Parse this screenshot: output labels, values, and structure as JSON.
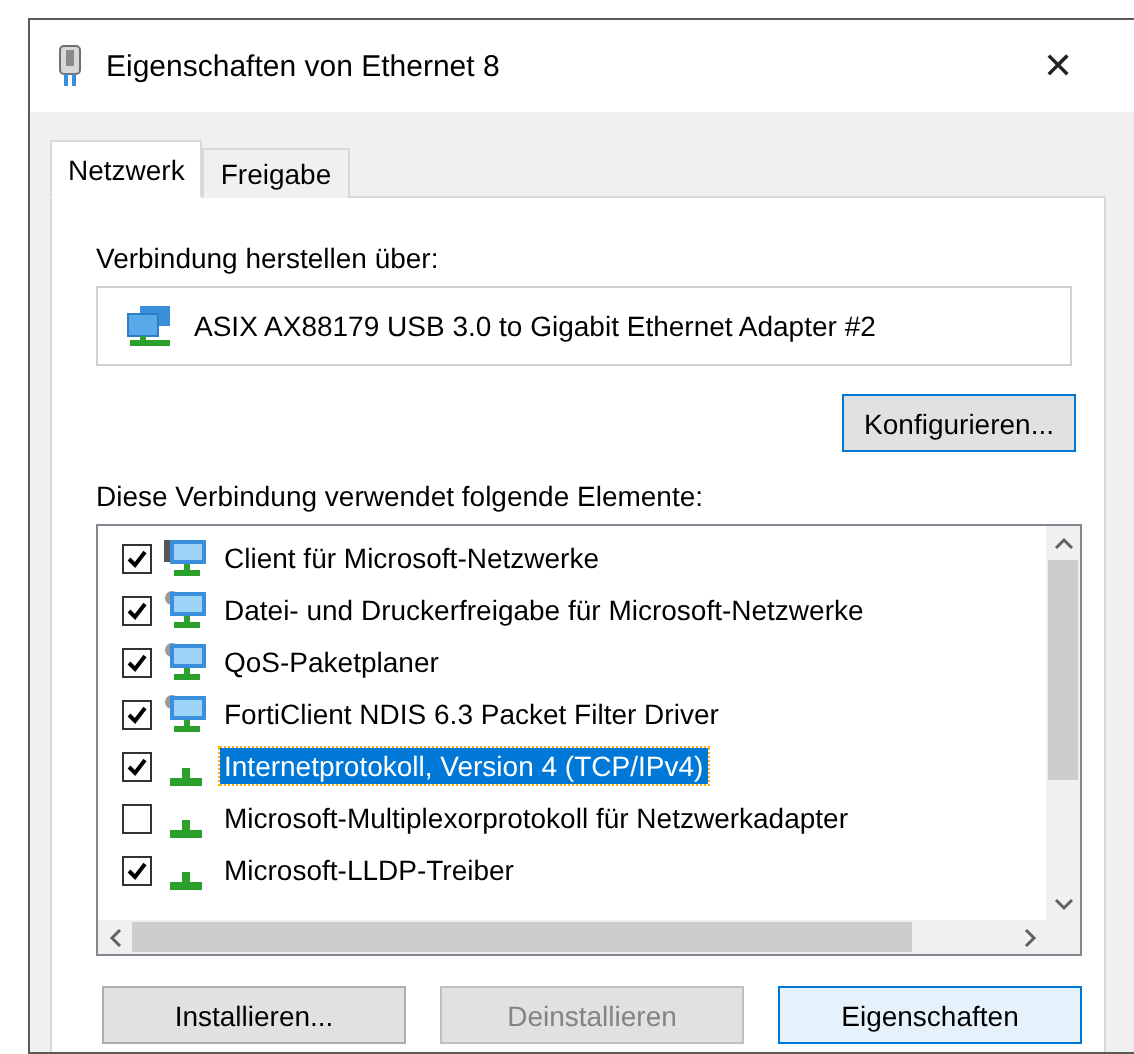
{
  "window": {
    "title": "Eigenschaften von Ethernet 8",
    "close": "✕"
  },
  "tabs": [
    {
      "label": "Netzwerk",
      "selected": true
    },
    {
      "label": "Freigabe",
      "selected": false
    }
  ],
  "connect_label": "Verbindung herstellen über:",
  "adapter": "ASIX AX88179 USB 3.0 to Gigabit Ethernet Adapter #2",
  "configure_button": "Konfigurieren...",
  "elements_label": "Diese Verbindung verwendet folgende Elemente:",
  "elements": [
    {
      "label": "Client für Microsoft-Netzwerke",
      "kind": "client",
      "checked": true,
      "selected": false
    },
    {
      "label": "Datei- und Druckerfreigabe für Microsoft-Netzwerke",
      "kind": "service",
      "checked": true,
      "selected": false
    },
    {
      "label": "QoS-Paketplaner",
      "kind": "service",
      "checked": true,
      "selected": false
    },
    {
      "label": "FortiClient NDIS 6.3 Packet Filter Driver",
      "kind": "service",
      "checked": true,
      "selected": false
    },
    {
      "label": "Internetprotokoll, Version 4 (TCP/IPv4)",
      "kind": "protocol",
      "checked": true,
      "selected": true
    },
    {
      "label": "Microsoft-Multiplexorprotokoll für Netzwerkadapter",
      "kind": "protocol",
      "checked": false,
      "selected": false
    },
    {
      "label": "Microsoft-LLDP-Treiber",
      "kind": "protocol",
      "checked": true,
      "selected": false
    }
  ],
  "buttons": [
    {
      "label": "Installieren...",
      "disabled": false,
      "selected": false
    },
    {
      "label": "Deinstallieren",
      "disabled": true,
      "selected": false
    },
    {
      "label": "Eigenschaften",
      "disabled": false,
      "selected": true
    }
  ]
}
